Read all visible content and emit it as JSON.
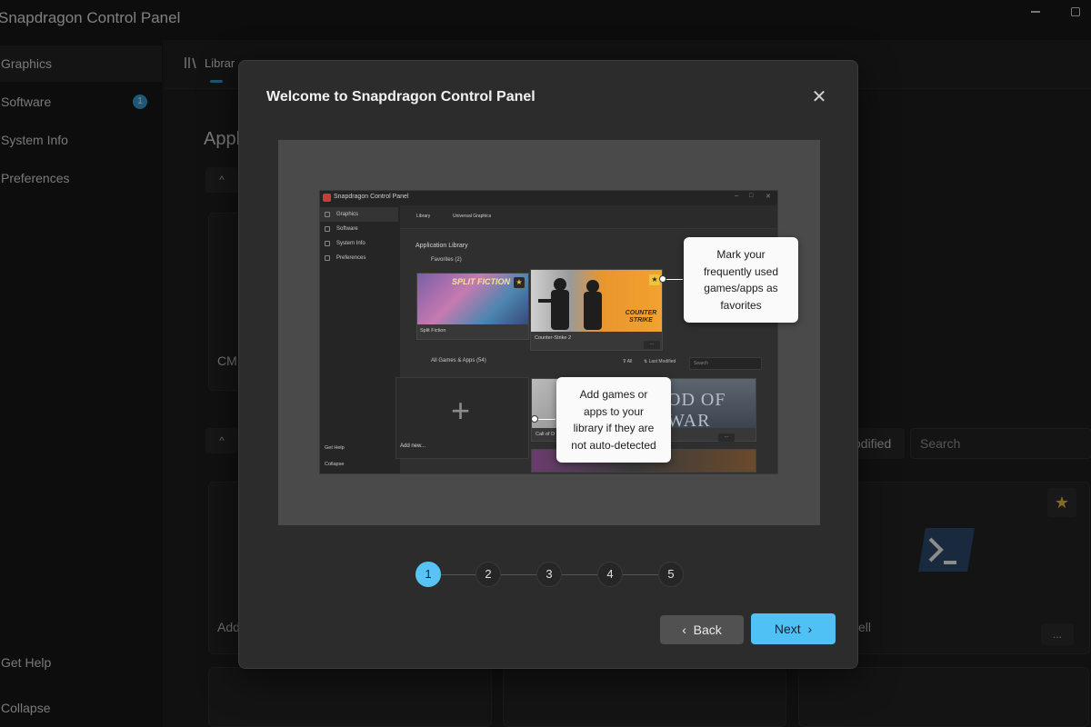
{
  "app": {
    "title": "Snapdragon Control Panel"
  },
  "sidebar": {
    "items": [
      {
        "label": "Graphics",
        "active": true
      },
      {
        "label": "Software",
        "badge": "1"
      },
      {
        "label": "System Info"
      },
      {
        "label": "Preferences"
      }
    ],
    "bottom": [
      {
        "label": "Get Help"
      },
      {
        "label": "Collapse"
      }
    ]
  },
  "main": {
    "tab_label": "Librar",
    "heading": "Appl",
    "card_texts": [
      "CM",
      "Add",
      "ell"
    ],
    "filter_label": "odified",
    "search_placeholder": "Search",
    "collapse_glyph": "^",
    "more_glyph": "..."
  },
  "dialog": {
    "title": "Welcome to Snapdragon Control Panel",
    "close_glyph": "✕",
    "preview": {
      "window_title": "Snapdragon Control Panel",
      "nav": [
        "Graphics",
        "Software",
        "System Info",
        "Preferences"
      ],
      "tabs": [
        "Library",
        "Universal Graphics"
      ],
      "heading": "Application Library",
      "favorites_label": "Favorites",
      "favorites_count": "(2)",
      "all_label": "All Games & Apps",
      "all_count": "(54)",
      "filter_all": "All",
      "filter_sort": "Last Modified",
      "search": "Search",
      "games": {
        "split_fiction": "Split Fiction",
        "counter_strike": "Counter-Strike 2",
        "call_of_duty": "Call of D",
        "gow_title": "OD OF WAR"
      },
      "add_new": "Add new...",
      "bottom_nav": [
        "Get Help",
        "Collapse"
      ],
      "cs_logo": "COUNTER STRIKE",
      "split_logo": "SPLIT FICTION"
    },
    "callouts": {
      "favorites": [
        "Mark your",
        "frequently used",
        "games/apps as",
        "favorites"
      ],
      "add": [
        "Add games or",
        "apps to your",
        "library if they are",
        "not auto-detected"
      ]
    },
    "steps": [
      "1",
      "2",
      "3",
      "4",
      "5"
    ],
    "active_step": 1,
    "back_label": "Back",
    "next_label": "Next"
  },
  "colors": {
    "accent": "#58c4f6",
    "star": "#f0c33c",
    "badge": "#3aa0d8"
  }
}
